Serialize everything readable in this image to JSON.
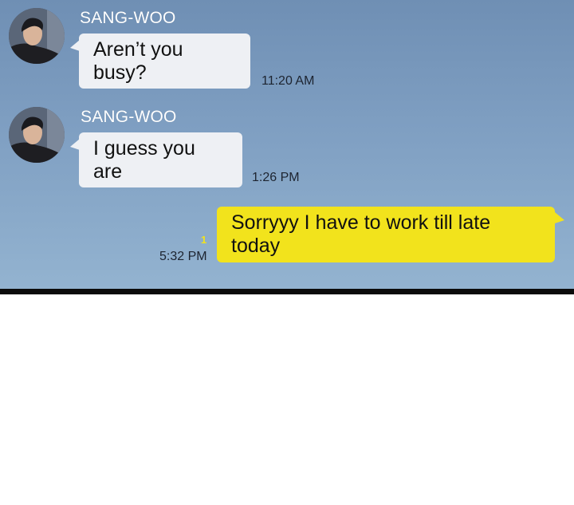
{
  "colors": {
    "background": "#7f9fc2",
    "incoming_bubble": "#eef0f4",
    "outgoing_bubble": "#f2e31c",
    "unread_count": "#f2e31c",
    "divider": "#0b0b0b"
  },
  "messages": [
    {
      "sender": "SANG-WOO",
      "text": "Aren’t you busy?",
      "time": "11:20 AM",
      "direction": "incoming",
      "avatar_icon": "profile-avatar"
    },
    {
      "sender": "SANG-WOO",
      "text": "I guess you are",
      "time": "1:26 PM",
      "direction": "incoming",
      "avatar_icon": "profile-avatar"
    },
    {
      "text": "Sorryyy I have to work till late today",
      "time": "5:32 PM",
      "direction": "outgoing",
      "unread_count": "1"
    }
  ]
}
